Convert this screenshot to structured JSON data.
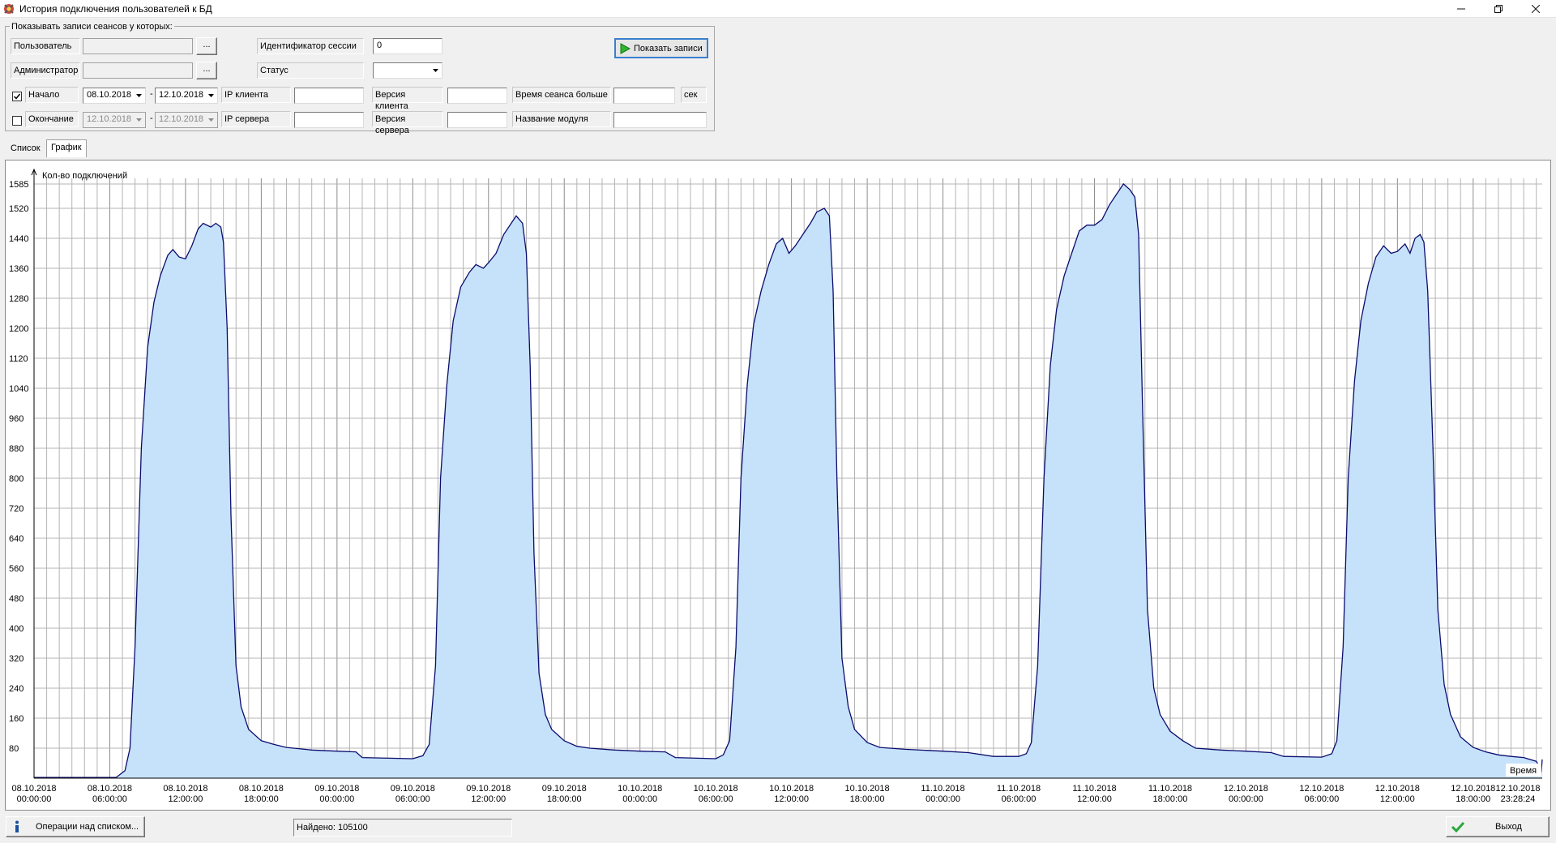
{
  "window": {
    "title": "История подключения пользователей к БД"
  },
  "filter": {
    "group_title": "Показывать записи сеансов у которых:",
    "user_label": "Пользователь",
    "user_value": "",
    "user_browse": "...",
    "admin_label": "Администратор",
    "admin_value": "",
    "admin_browse": "...",
    "session_id_label": "Идентификатор сессии",
    "session_id_value": "0",
    "status_label": "Статус",
    "status_value": "",
    "start_checked": true,
    "start_label": "Начало",
    "start_from": "08.10.2018",
    "start_to": "12.10.2018",
    "end_checked": false,
    "end_label": "Окончание",
    "end_from": "12.10.2018",
    "end_to": "12.10.2018",
    "range_dash": "-",
    "client_ip_label": "IP клиента",
    "client_ip_value": "",
    "server_ip_label": "IP сервера",
    "server_ip_value": "",
    "client_version_label": "Версия клиента",
    "client_version_value": "",
    "server_version_label": "Версия сервера",
    "server_version_value": "",
    "session_time_label": "Время сеанса больше",
    "session_time_value": "",
    "session_time_unit": "сек",
    "module_name_label": "Название модуля",
    "module_name_value": "",
    "show_button": "Показать записи"
  },
  "tabs": [
    {
      "label": "Список",
      "active": false
    },
    {
      "label": "График",
      "active": true
    }
  ],
  "chart_data": {
    "type": "area",
    "ylabel": "Кол-во подключений",
    "xlabel": "Время",
    "y_ticks": [
      80,
      160,
      240,
      320,
      400,
      480,
      560,
      640,
      720,
      800,
      880,
      960,
      1040,
      1120,
      1200,
      1280,
      1360,
      1440,
      1520,
      1585
    ],
    "ylim": [
      0,
      1600
    ],
    "x_tick_labels": [
      {
        "date": "08.10.2018",
        "time": "00:00:00",
        "h": 0
      },
      {
        "date": "08.10.2018",
        "time": "06:00:00",
        "h": 6
      },
      {
        "date": "08.10.2018",
        "time": "12:00:00",
        "h": 12
      },
      {
        "date": "08.10.2018",
        "time": "18:00:00",
        "h": 18
      },
      {
        "date": "09.10.2018",
        "time": "00:00:00",
        "h": 24
      },
      {
        "date": "09.10.2018",
        "time": "06:00:00",
        "h": 30
      },
      {
        "date": "09.10.2018",
        "time": "12:00:00",
        "h": 36
      },
      {
        "date": "09.10.2018",
        "time": "18:00:00",
        "h": 42
      },
      {
        "date": "10.10.2018",
        "time": "00:00:00",
        "h": 48
      },
      {
        "date": "10.10.2018",
        "time": "06:00:00",
        "h": 54
      },
      {
        "date": "10.10.2018",
        "time": "12:00:00",
        "h": 60
      },
      {
        "date": "10.10.2018",
        "time": "18:00:00",
        "h": 66
      },
      {
        "date": "11.10.2018",
        "time": "00:00:00",
        "h": 72
      },
      {
        "date": "11.10.2018",
        "time": "06:00:00",
        "h": 78
      },
      {
        "date": "11.10.2018",
        "time": "12:00:00",
        "h": 84
      },
      {
        "date": "11.10.2018",
        "time": "18:00:00",
        "h": 90
      },
      {
        "date": "12.10.2018",
        "time": "00:00:00",
        "h": 96
      },
      {
        "date": "12.10.2018",
        "time": "06:00:00",
        "h": 102
      },
      {
        "date": "12.10.2018",
        "time": "12:00:00",
        "h": 108
      },
      {
        "date": "12.10.2018",
        "time": "18:00:00",
        "h": 114
      },
      {
        "date": "12.10.2018",
        "time": "23:28:24",
        "h": 119.47
      }
    ],
    "x_range_hours": [
      0,
      119.47
    ],
    "series": [
      {
        "points": [
          [
            0,
            2
          ],
          [
            6.5,
            2
          ],
          [
            7.2,
            20
          ],
          [
            7.6,
            80
          ],
          [
            8.0,
            350
          ],
          [
            8.5,
            880
          ],
          [
            9.0,
            1150
          ],
          [
            9.5,
            1270
          ],
          [
            10.0,
            1340
          ],
          [
            10.6,
            1395
          ],
          [
            11.0,
            1410
          ],
          [
            11.5,
            1390
          ],
          [
            12.0,
            1385
          ],
          [
            12.5,
            1420
          ],
          [
            13.0,
            1465
          ],
          [
            13.4,
            1480
          ],
          [
            14.0,
            1470
          ],
          [
            14.4,
            1480
          ],
          [
            14.8,
            1470
          ],
          [
            15.0,
            1430
          ],
          [
            15.3,
            1200
          ],
          [
            15.6,
            700
          ],
          [
            16.0,
            300
          ],
          [
            16.4,
            190
          ],
          [
            17.0,
            130
          ],
          [
            18.0,
            100
          ],
          [
            19.0,
            90
          ],
          [
            20.0,
            82
          ],
          [
            22.0,
            75
          ],
          [
            24.0,
            72
          ],
          [
            25.5,
            70
          ],
          [
            26.0,
            55
          ],
          [
            30.0,
            52
          ],
          [
            30.8,
            60
          ],
          [
            31.3,
            90
          ],
          [
            31.8,
            300
          ],
          [
            32.2,
            800
          ],
          [
            32.7,
            1050
          ],
          [
            33.2,
            1220
          ],
          [
            33.8,
            1310
          ],
          [
            34.5,
            1350
          ],
          [
            35.0,
            1370
          ],
          [
            35.6,
            1360
          ],
          [
            36.0,
            1375
          ],
          [
            36.6,
            1400
          ],
          [
            37.2,
            1450
          ],
          [
            37.8,
            1480
          ],
          [
            38.2,
            1500
          ],
          [
            38.7,
            1480
          ],
          [
            39.0,
            1400
          ],
          [
            39.3,
            1100
          ],
          [
            39.6,
            600
          ],
          [
            40.0,
            280
          ],
          [
            40.5,
            170
          ],
          [
            41.0,
            130
          ],
          [
            42.0,
            100
          ],
          [
            43.0,
            85
          ],
          [
            44.0,
            80
          ],
          [
            46.0,
            75
          ],
          [
            48.0,
            72
          ],
          [
            50.0,
            70
          ],
          [
            50.8,
            55
          ],
          [
            54.0,
            52
          ],
          [
            54.6,
            62
          ],
          [
            55.1,
            100
          ],
          [
            55.6,
            350
          ],
          [
            56.0,
            800
          ],
          [
            56.5,
            1050
          ],
          [
            57.0,
            1210
          ],
          [
            57.6,
            1300
          ],
          [
            58.2,
            1370
          ],
          [
            58.8,
            1425
          ],
          [
            59.3,
            1440
          ],
          [
            59.8,
            1400
          ],
          [
            60.3,
            1420
          ],
          [
            60.9,
            1450
          ],
          [
            61.5,
            1480
          ],
          [
            62.0,
            1510
          ],
          [
            62.6,
            1520
          ],
          [
            63.0,
            1500
          ],
          [
            63.3,
            1300
          ],
          [
            63.6,
            800
          ],
          [
            64.0,
            320
          ],
          [
            64.5,
            190
          ],
          [
            65.0,
            130
          ],
          [
            66.0,
            95
          ],
          [
            67.0,
            82
          ],
          [
            69.0,
            77
          ],
          [
            72.0,
            72
          ],
          [
            74.0,
            68
          ],
          [
            76.0,
            58
          ],
          [
            78.0,
            58
          ],
          [
            78.6,
            65
          ],
          [
            79.0,
            95
          ],
          [
            79.5,
            300
          ],
          [
            80.0,
            800
          ],
          [
            80.5,
            1100
          ],
          [
            81.0,
            1250
          ],
          [
            81.6,
            1340
          ],
          [
            82.2,
            1400
          ],
          [
            82.8,
            1460
          ],
          [
            83.4,
            1475
          ],
          [
            84.0,
            1475
          ],
          [
            84.6,
            1490
          ],
          [
            85.2,
            1530
          ],
          [
            85.8,
            1560
          ],
          [
            86.3,
            1585
          ],
          [
            86.8,
            1570
          ],
          [
            87.2,
            1550
          ],
          [
            87.5,
            1450
          ],
          [
            87.8,
            1000
          ],
          [
            88.2,
            450
          ],
          [
            88.7,
            240
          ],
          [
            89.2,
            170
          ],
          [
            90.0,
            125
          ],
          [
            91.0,
            100
          ],
          [
            92.0,
            80
          ],
          [
            94.0,
            75
          ],
          [
            96.0,
            72
          ],
          [
            98.0,
            68
          ],
          [
            99.0,
            58
          ],
          [
            102.0,
            56
          ],
          [
            102.8,
            65
          ],
          [
            103.2,
            100
          ],
          [
            103.7,
            350
          ],
          [
            104.1,
            800
          ],
          [
            104.6,
            1060
          ],
          [
            105.1,
            1220
          ],
          [
            105.7,
            1320
          ],
          [
            106.3,
            1390
          ],
          [
            106.9,
            1420
          ],
          [
            107.5,
            1400
          ],
          [
            108.0,
            1405
          ],
          [
            108.6,
            1425
          ],
          [
            109.0,
            1400
          ],
          [
            109.4,
            1440
          ],
          [
            109.8,
            1450
          ],
          [
            110.1,
            1430
          ],
          [
            110.4,
            1300
          ],
          [
            110.8,
            900
          ],
          [
            111.2,
            450
          ],
          [
            111.7,
            250
          ],
          [
            112.2,
            170
          ],
          [
            113.0,
            110
          ],
          [
            114.0,
            82
          ],
          [
            115.0,
            70
          ],
          [
            116.0,
            62
          ],
          [
            117.0,
            58
          ],
          [
            118.0,
            55
          ],
          [
            119.0,
            45
          ],
          [
            119.4,
            20
          ],
          [
            119.47,
            50
          ]
        ]
      }
    ],
    "grid": true,
    "colors": {
      "fill": "#c5e2fa",
      "line": "#0c0c6e",
      "grid": "#b4b4b4"
    }
  },
  "status": {
    "operations_button": "Операции над списком...",
    "found_text": "Найдено: 105100",
    "exit_button": "Выход"
  }
}
